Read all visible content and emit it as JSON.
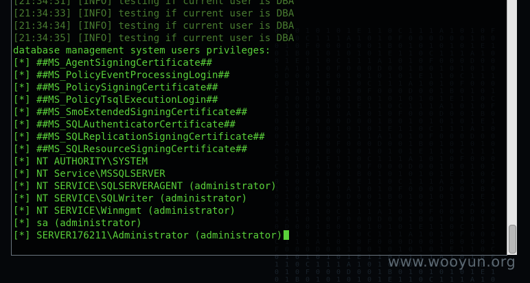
{
  "terminal": {
    "lines": [
      {
        "text": "[21:34:31] [INFO] testing if current user is DBA",
        "kind": "log"
      },
      {
        "text": "[21:34:33] [INFO] testing if current user is DBA",
        "kind": "log"
      },
      {
        "text": "[21:34:34] [INFO] testing if current user is DBA",
        "kind": "log"
      },
      {
        "text": "[21:34:35] [INFO] testing if current user is DBA",
        "kind": "log"
      },
      {
        "text": "database management system users privileges:",
        "kind": "out"
      },
      {
        "text": "[*] ##MS_AgentSigningCertificate##",
        "kind": "out"
      },
      {
        "text": "[*] ##MS_PolicyEventProcessingLogin##",
        "kind": "out"
      },
      {
        "text": "[*] ##MS_PolicySigningCertificate##",
        "kind": "out"
      },
      {
        "text": "[*] ##MS_PolicyTsqlExecutionLogin##",
        "kind": "out"
      },
      {
        "text": "[*] ##MS_SmoExtendedSigningCertificate##",
        "kind": "out"
      },
      {
        "text": "[*] ##MS_SQLAuthenticatorCertificate##",
        "kind": "out"
      },
      {
        "text": "[*] ##MS_SQLReplicationSigningCertificate##",
        "kind": "out"
      },
      {
        "text": "[*] ##MS_SQLResourceSigningCertificate##",
        "kind": "out"
      },
      {
        "text": "[*] NT AUTHORITY\\SYSTEM",
        "kind": "out"
      },
      {
        "text": "[*] NT Service\\MSSQLSERVER",
        "kind": "out"
      },
      {
        "text": "[*] NT SERVICE\\SQLSERVERAGENT (administrator)",
        "kind": "out"
      },
      {
        "text": "[*] NT SERVICE\\SQLWriter (administrator)",
        "kind": "out"
      },
      {
        "text": "[*] NT SERVICE\\Winmgmt (administrator)",
        "kind": "out"
      },
      {
        "text": "[*] sa (administrator)",
        "kind": "out"
      },
      {
        "text": "[*] SERVER176211\\Administrator (administrator)",
        "kind": "out"
      }
    ]
  },
  "watermark": "www.wooyun.org",
  "colors": {
    "output": "#5ad13a",
    "log": "#4a7d31",
    "background": "#05070a"
  }
}
